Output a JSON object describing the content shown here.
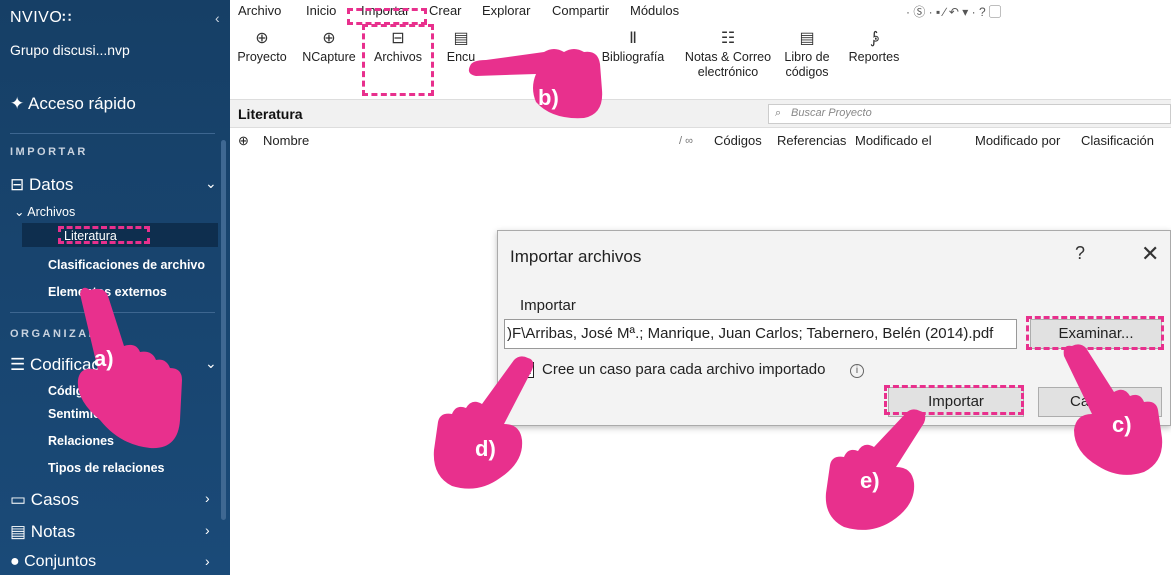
{
  "sidebar": {
    "brand": "NVIVO",
    "brand_mark": "∷",
    "collapse_glyph": "‹",
    "project": "Grupo discusi...nvp",
    "quick_access": "Acceso rápido",
    "import_header": "IMPORTAR",
    "organize_header": "ORGANIZAR",
    "datos": "Datos",
    "archivos": "Archivos",
    "literatura": "Literatura",
    "clasificaciones": "Clasificaciones de archivo",
    "externos": "Elementos externos",
    "codificacion": "Codificación",
    "codigos": "Códigos",
    "sentimiento": "Sentimiento",
    "relaciones": "Relaciones",
    "tipos": "Tipos de relaciones",
    "casos": "Casos",
    "notas": "Notas",
    "conjuntos": "Conjuntos"
  },
  "menu": {
    "items": [
      "Archivo",
      "Inicio",
      "Importar",
      "Crear",
      "Explorar",
      "Compartir",
      "Módulos"
    ],
    "qa": "· Ⓢ · ▪ ∕ ↶ ▾ · ? ▢"
  },
  "ribbon": {
    "proyecto": "Proyecto",
    "ncapture": "NCapture",
    "archivos": "Archivos",
    "encuestas": "Encu",
    "bibliografia": "Bibliografía",
    "notas1": "Notas & Correo",
    "notas2": "electrónico",
    "libro1": "Libro de",
    "libro2": "códigos",
    "reportes": "Reportes",
    "icons": {
      "proyecto": "⊕",
      "ncapture": "⊕",
      "archivos": "⊟",
      "encuestas": "▤",
      "bibliografia": "Ⅱ",
      "notas": "☷",
      "libro": "▤",
      "reportes": "⨔"
    }
  },
  "nav": {
    "title": "Literatura",
    "search_placeholder": "Buscar Proyecto",
    "search_icon": "⌕"
  },
  "columns": {
    "add_icon": "⊕",
    "name": "Nombre",
    "link_icon": "/ ∞",
    "codigos": "Códigos",
    "referencias": "Referencias",
    "modificado_el": "Modificado el",
    "modificado_por": "Modificado por",
    "clasificacion": "Clasificación"
  },
  "dialog": {
    "title": "Importar archivos",
    "help": "?",
    "close": "✕",
    "import_label": "Importar",
    "path": ")F\\Arribas, José Mª.; Manrique, Juan Carlos; Tabernero, Belén (2014).pdf",
    "browse": "Examinar...",
    "check_mark": "X",
    "checkbox_label": "Cree un caso para cada archivo importado",
    "info_glyph": "i",
    "import_button": "Importar",
    "cancel_button": "Cancelar"
  },
  "annotations": {
    "a": "a)",
    "b": "b)",
    "c": "c)",
    "d": "d)",
    "e": "e)",
    "accent": "#e8308d"
  }
}
